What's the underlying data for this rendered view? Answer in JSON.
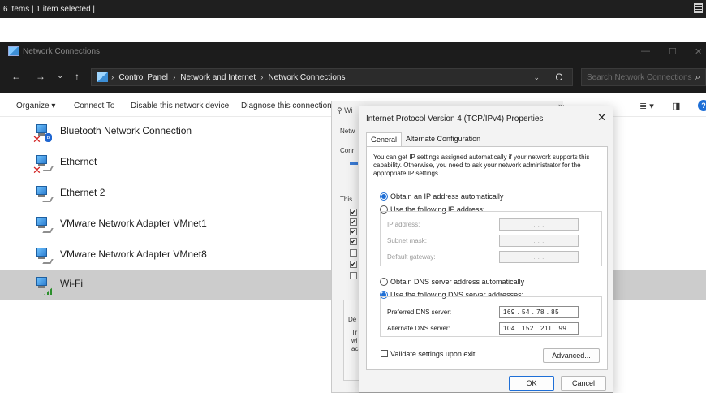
{
  "status_bar": {
    "text": "6 items  |  1 item selected  |"
  },
  "window": {
    "title": "Network Connections",
    "controls": {
      "minimize": "—",
      "maximize": "☐",
      "close": "✕"
    }
  },
  "address_bar": {
    "nav": {
      "back": "←",
      "forward": "→",
      "recent": "⌄",
      "up": "↑"
    },
    "breadcrumbs": [
      "Control Panel",
      "Network and Internet",
      "Network Connections"
    ],
    "separator": "›",
    "dropdown": "⌄",
    "refresh": "C"
  },
  "search": {
    "placeholder": "Search Network Connections"
  },
  "command_bar": {
    "organize": "Organize ▾",
    "connect_to": "Connect To",
    "disable_device": "Disable this network device",
    "diagnose": "Diagnose this connection",
    "more": "»",
    "view_options": "≣ ▾",
    "preview_pane": "◨",
    "help": "?"
  },
  "connections": [
    {
      "name": "Bluetooth Network Connection",
      "icon": "bluetooth-network-icon",
      "status": "disabled"
    },
    {
      "name": "Ethernet",
      "icon": "ethernet-icon",
      "status": "disabled"
    },
    {
      "name": "Ethernet 2",
      "icon": "ethernet-icon",
      "status": "enabled"
    },
    {
      "name": "VMware Network Adapter VMnet1",
      "icon": "ethernet-icon",
      "status": "enabled"
    },
    {
      "name": "VMware Network Adapter VMnet8",
      "icon": "ethernet-icon",
      "status": "enabled"
    },
    {
      "name": "Wi-Fi",
      "icon": "wifi-icon",
      "status": "selected"
    }
  ],
  "bg_dialog": {
    "tab_label": "Wi",
    "networking_tab": "Netw",
    "connect_using": "Conr",
    "this_conn": "This",
    "checked_marks": [
      "✔",
      "✔",
      "✔",
      "✔",
      "",
      "✔",
      ""
    ],
    "description": "De",
    "desc_lines": [
      "Tr",
      "wi",
      "ac"
    ]
  },
  "ipv4_dialog": {
    "title": "Internet Protocol Version 4 (TCP/IPv4) Properties",
    "close": "✕",
    "tabs": [
      "General",
      "Alternate Configuration"
    ],
    "intro": "You can get IP settings assigned automatically if your network supports this capability. Otherwise, you need to ask your network administrator for the appropriate IP settings.",
    "ip_auto": "Obtain an IP address automatically",
    "ip_manual": "Use the following IP address:",
    "ip_address_label": "IP address:",
    "subnet_label": "Subnet mask:",
    "gateway_label": "Default gateway:",
    "empty_ip": ".     .     .",
    "dns_auto": "Obtain DNS server address automatically",
    "dns_manual": "Use the following DNS server addresses:",
    "preferred_label": "Preferred DNS server:",
    "preferred_value": "169 . 54 . 78 . 85",
    "alternate_label": "Alternate DNS server:",
    "alternate_value": "104 . 152 . 211 . 99",
    "validate_label": "Validate settings upon exit",
    "advanced": "Advanced...",
    "ok": "OK",
    "cancel": "Cancel"
  }
}
